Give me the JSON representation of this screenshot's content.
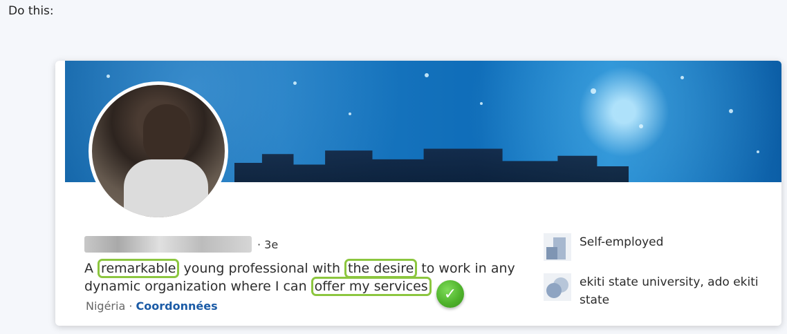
{
  "instruction": "Do this:",
  "profile": {
    "degree": "· 3e",
    "headline": {
      "t1": "A ",
      "h1": "remarkable",
      "t2": " young professional with ",
      "h2": "the desire",
      "t3": " to work in any dynamic organization where I can ",
      "h3": "offer my services"
    },
    "location": "Nigéria",
    "separator": " · ",
    "contact_label": "Coordonnées"
  },
  "side": {
    "employer": "Self-employed",
    "school": "ekiti state university, ado ekiti state"
  },
  "colors": {
    "highlight_border": "#8cc63f",
    "link": "#1b5ba6",
    "check_badge": "#4fb32c"
  },
  "icons": {
    "check": "checkmark-icon",
    "company": "company-logo-icon",
    "school": "school-logo-icon"
  }
}
